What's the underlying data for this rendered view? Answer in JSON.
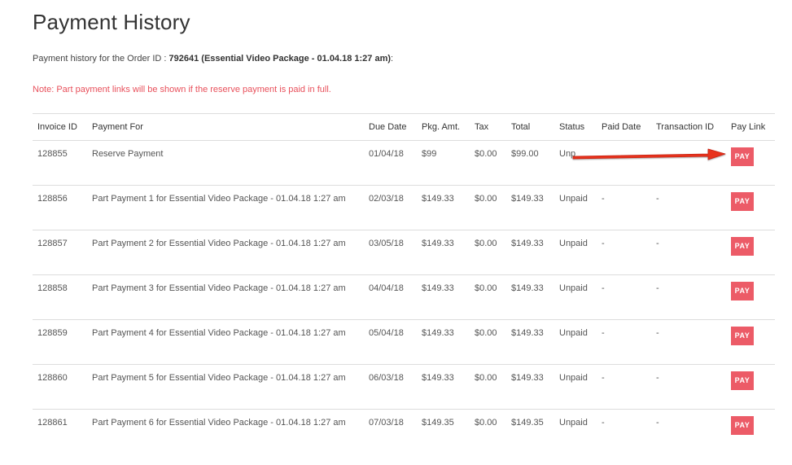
{
  "page": {
    "title": "Payment History",
    "order_prefix": "Payment history for the Order ID : ",
    "order_detail": "792641 (Essential Video Package - 01.04.18 1:27 am)",
    "order_suffix": ":",
    "note": "Note: Part payment links will be shown if the reserve payment is paid in full."
  },
  "table": {
    "headers": [
      "Invoice ID",
      "Payment For",
      "Due Date",
      "Pkg. Amt.",
      "Tax",
      "Total",
      "Status",
      "Paid Date",
      "Transaction ID",
      "Pay Link"
    ],
    "pay_label": "PAY",
    "rows": [
      {
        "invoice": "128855",
        "payment_for": "Reserve Payment",
        "due": "01/04/18",
        "pkg": "$99",
        "tax": "$0.00",
        "total": "$99.00",
        "status": "Unp",
        "paid_date": "",
        "txn": ""
      },
      {
        "invoice": "128856",
        "payment_for": "Part Payment 1 for Essential Video Package - 01.04.18 1:27 am",
        "due": "02/03/18",
        "pkg": "$149.33",
        "tax": "$0.00",
        "total": "$149.33",
        "status": "Unpaid",
        "paid_date": "-",
        "txn": "-"
      },
      {
        "invoice": "128857",
        "payment_for": "Part Payment 2 for Essential Video Package - 01.04.18 1:27 am",
        "due": "03/05/18",
        "pkg": "$149.33",
        "tax": "$0.00",
        "total": "$149.33",
        "status": "Unpaid",
        "paid_date": "-",
        "txn": "-"
      },
      {
        "invoice": "128858",
        "payment_for": "Part Payment 3 for Essential Video Package - 01.04.18 1:27 am",
        "due": "04/04/18",
        "pkg": "$149.33",
        "tax": "$0.00",
        "total": "$149.33",
        "status": "Unpaid",
        "paid_date": "-",
        "txn": "-"
      },
      {
        "invoice": "128859",
        "payment_for": "Part Payment 4 for Essential Video Package - 01.04.18 1:27 am",
        "due": "05/04/18",
        "pkg": "$149.33",
        "tax": "$0.00",
        "total": "$149.33",
        "status": "Unpaid",
        "paid_date": "-",
        "txn": "-"
      },
      {
        "invoice": "128860",
        "payment_for": "Part Payment 5 for Essential Video Package - 01.04.18 1:27 am",
        "due": "06/03/18",
        "pkg": "$149.33",
        "tax": "$0.00",
        "total": "$149.33",
        "status": "Unpaid",
        "paid_date": "-",
        "txn": "-"
      },
      {
        "invoice": "128861",
        "payment_for": "Part Payment 6 for Essential Video Package - 01.04.18 1:27 am",
        "due": "07/03/18",
        "pkg": "$149.35",
        "tax": "$0.00",
        "total": "$149.35",
        "status": "Unpaid",
        "paid_date": "-",
        "txn": "-"
      }
    ]
  },
  "colors": {
    "accent": "#ec5b67",
    "note": "#e8505b",
    "arrow": "#e8331f"
  },
  "annotation": {
    "icon": "red-arrow-icon"
  }
}
